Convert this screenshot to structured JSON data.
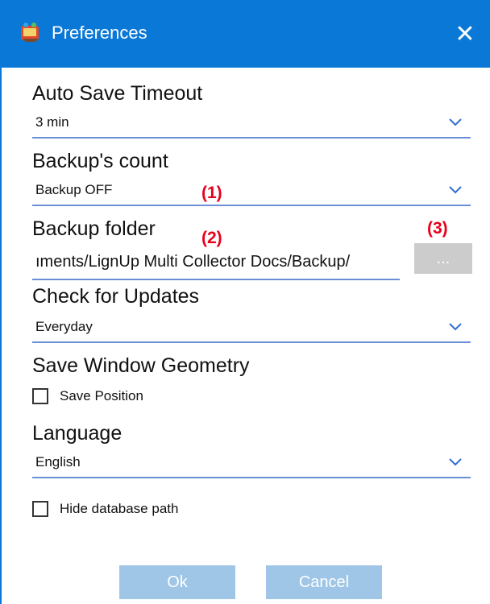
{
  "window": {
    "title": "Preferences",
    "close_glyph": "✕",
    "accent_color": "#0a78d6",
    "app_icon": "app-logo-icon"
  },
  "auto_save": {
    "label": "Auto Save Timeout",
    "value": "3 min"
  },
  "backup_count": {
    "label": "Backup's count",
    "value": "Backup OFF",
    "annotation": "(1)"
  },
  "backup_folder": {
    "label": "Backup folder",
    "value": "ıments/LignUp Multi Collector Docs/Backup/",
    "annotation": "(2)",
    "browse_label": "...",
    "browse_annotation": "(3)"
  },
  "updates": {
    "label": "Check for Updates",
    "value": "Everyday"
  },
  "geometry": {
    "label": "Save Window Geometry",
    "save_position_label": "Save Position",
    "save_position_checked": false
  },
  "language": {
    "label": "Language",
    "value": "English"
  },
  "hide_db": {
    "label": "Hide database path",
    "checked": false
  },
  "buttons": {
    "ok": "Ok",
    "cancel": "Cancel"
  }
}
